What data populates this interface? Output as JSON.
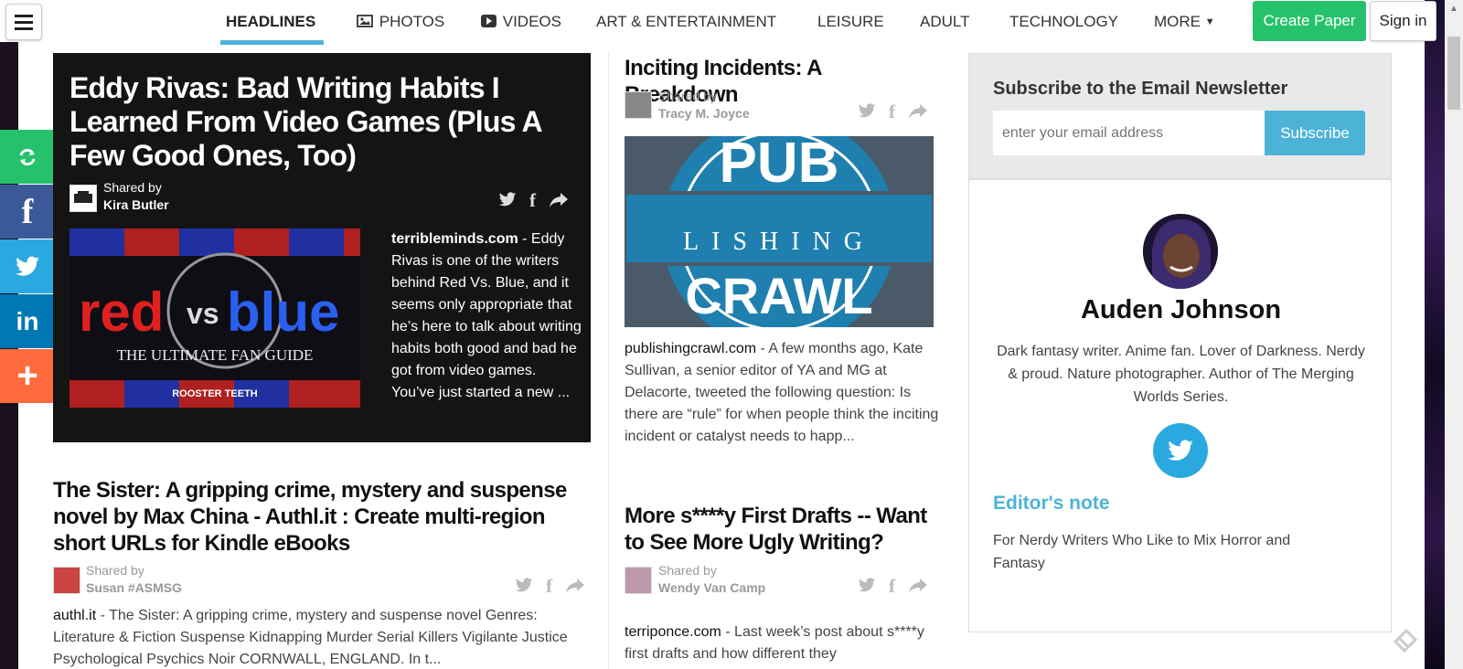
{
  "nav": {
    "items": [
      {
        "label": "HEADLINES",
        "icon": ""
      },
      {
        "label": "PHOTOS",
        "icon": "image-icon"
      },
      {
        "label": "VIDEOS",
        "icon": "play-icon"
      },
      {
        "label": "ART & ENTERTAINMENT",
        "icon": ""
      },
      {
        "label": "LEISURE",
        "icon": ""
      },
      {
        "label": "ADULT",
        "icon": ""
      },
      {
        "label": "TECHNOLOGY",
        "icon": ""
      },
      {
        "label": "MORE",
        "icon": "caret-down-icon"
      }
    ],
    "create_label": "Create Paper",
    "signin_label": "Sign in"
  },
  "colors": {
    "accent": "#4db3d6",
    "create": "#26c26b",
    "share_refresh": "#26c26b",
    "share_facebook": "#3b5998",
    "share_twitter": "#2aa9e0",
    "share_linkedin": "#0077b5",
    "share_more": "#ff6b3d"
  },
  "featured": {
    "title": "Eddy Rivas: Bad Writing Habits I Learned From Video Games (Plus A Few Good Ones, Too)",
    "shared_by_label": "Shared by",
    "author": "Kira Butler",
    "domain": "terribleminds.com",
    "excerpt": " - Eddy Rivas is one of the writers behind Red Vs. Blue, and it seems only appropriate that he’s here to talk about writing habits both good and bad he got from video games. You’ve just started a new ...",
    "image_text_red": "red",
    "image_text_vs": "vs",
    "image_text_blue": "blue",
    "image_caption": "THE ULTIMATE FAN GUIDE",
    "image_brand": "ROOSTER TEETH"
  },
  "article_sister": {
    "title": "The Sister: A gripping crime, mystery and suspense novel by Max China - Authl.it : Create multi-region short URLs for Kindle eBooks",
    "shared_by_label": "Shared by",
    "author": "Susan #ASMSG",
    "domain": "authl.it",
    "excerpt": " - The Sister: A gripping crime, mystery and suspense novel Genres: Literature & Fiction Suspense Kidnapping Murder Serial Killers Vigilante Justice Psychological Psychics Noir CORNWALL, ENGLAND. In t..."
  },
  "article_inciting": {
    "title": "Inciting Incidents: A Breakdown",
    "shared_by_label": "Shared by",
    "author": "Tracy M. Joyce",
    "domain": "publishingcrawl.com",
    "excerpt": " - A few months ago, Kate Sullivan, a senior editor of YA and MG at Delacorte, tweeted the following question: Is there are “rule” for when people think the inciting incident or catalyst needs to happ...",
    "image_pub": "PUB",
    "image_lishing": "LISHING",
    "image_crawl": "CRAWL"
  },
  "article_drafts": {
    "title": "More s****y First Drafts -- Want to See More Ugly Writing?",
    "shared_by_label": "Shared by",
    "author": "Wendy Van Camp",
    "domain": "terriponce.com",
    "excerpt": " - Last week’s post about s****y first drafts and how different they"
  },
  "newsletter": {
    "title": "Subscribe to the Email Newsletter",
    "placeholder": "enter your email address",
    "button_label": "Subscribe"
  },
  "editor": {
    "name": "Auden Johnson",
    "bio": "Dark fantasy writer. Anime fan. Lover of Darkness. Nerdy & proud. Nature photographer. Author of The Merging Worlds Series.",
    "note_title": "Editor's note",
    "note_text": "For Nerdy Writers Who Like to Mix Horror and Fantasy"
  }
}
